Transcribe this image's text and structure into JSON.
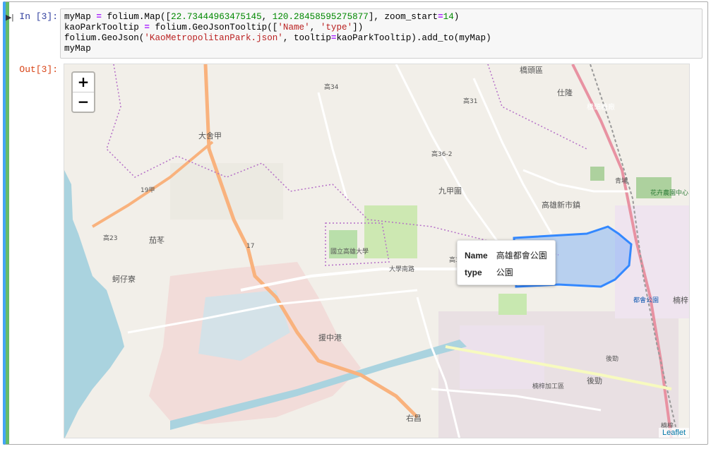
{
  "cell": {
    "run_marker": "▶|",
    "in_prompt": "In [3]:",
    "out_prompt": "Out[3]:",
    "code_lines": [
      [
        {
          "t": "myMap ",
          "c": ""
        },
        {
          "t": "=",
          "c": "op"
        },
        {
          "t": " folium.Map([",
          "c": ""
        },
        {
          "t": "22.73444963475145",
          "c": "num"
        },
        {
          "t": ", ",
          "c": ""
        },
        {
          "t": "120.28458595275877",
          "c": "num"
        },
        {
          "t": "], zoom_start",
          "c": ""
        },
        {
          "t": "=",
          "c": "op"
        },
        {
          "t": "14",
          "c": "num"
        },
        {
          "t": ")",
          "c": ""
        }
      ],
      [
        {
          "t": "kaoParkTooltip ",
          "c": ""
        },
        {
          "t": "=",
          "c": "op"
        },
        {
          "t": " folium.GeoJsonTooltip([",
          "c": ""
        },
        {
          "t": "'Name'",
          "c": "str"
        },
        {
          "t": ", ",
          "c": ""
        },
        {
          "t": "'type'",
          "c": "str"
        },
        {
          "t": "])",
          "c": ""
        }
      ],
      [
        {
          "t": "folium.GeoJson(",
          "c": ""
        },
        {
          "t": "'KaoMetropolitanPark.json'",
          "c": "str"
        },
        {
          "t": ", tooltip",
          "c": ""
        },
        {
          "t": "=",
          "c": "op"
        },
        {
          "t": "kaoParkTooltip).add_to(myMap)",
          "c": ""
        }
      ],
      [
        {
          "t": "myMap",
          "c": ""
        }
      ]
    ]
  },
  "map": {
    "zoom_in": "+",
    "zoom_out": "−",
    "attribution": "Leaflet",
    "tooltip": {
      "rows": [
        {
          "key": "Name",
          "value": "高雄都會公園"
        },
        {
          "key": "type",
          "value": "公園"
        }
      ]
    },
    "labels": {
      "qiaotou": "橋頭區",
      "shilong": "仕隆",
      "qiaotou_station": "橋頭糖廠",
      "dashe_jia": "大舍甲",
      "road_19jia": "19甲",
      "gao31": "高31",
      "gao34": "高34",
      "gao36_2": "高36-2",
      "jiujiawei": "九甲圍",
      "gaoxiong_new_city": "高雄新市鎮",
      "qingpu": "青埔",
      "flower_center": "花卉農園中心",
      "gao23": "高23",
      "wudong": "茄苳",
      "road_17": "17",
      "university": "國立高雄大學",
      "gao30": "高30",
      "kezizhai": "蚵仔寮",
      "daxue_rd": "大學南路",
      "houjiaozi": "援中港",
      "metro_park_station": "都會公園",
      "nanzi_epz": "楠梓加工區",
      "houjin": "後勁",
      "houjin2": "後勁",
      "youchang": "右昌",
      "nanzi": "楠梓",
      "nanzi2": "楠梓"
    }
  },
  "colors": {
    "sea": "#aad3df",
    "land": "#f2efe9",
    "park_fill": "#4aa8ff",
    "park_stroke": "#3388ff"
  }
}
